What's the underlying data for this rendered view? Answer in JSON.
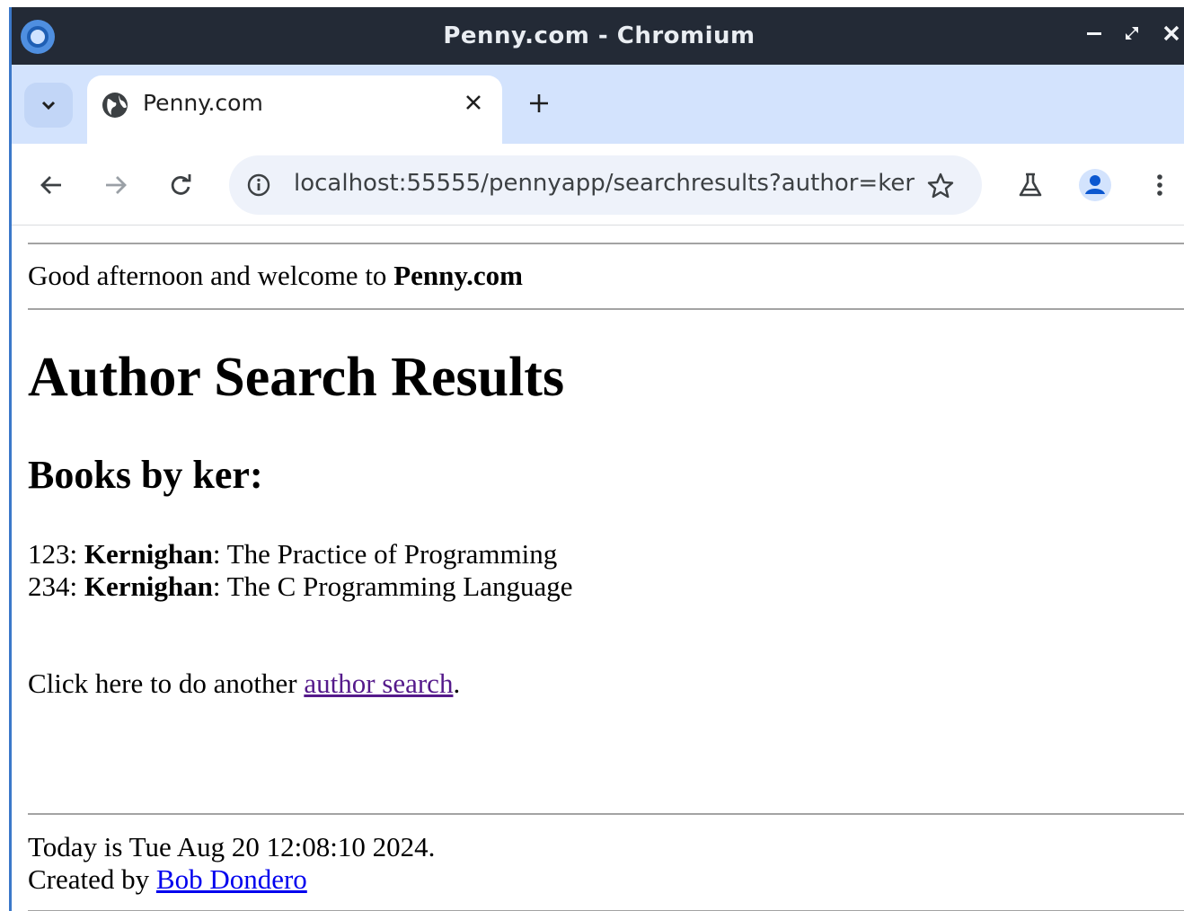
{
  "window": {
    "title": "Penny.com - Chromium"
  },
  "tabs": [
    {
      "label": "Penny.com"
    }
  ],
  "toolbar": {
    "url": "localhost:55555/pennyapp/searchresults?author=ker"
  },
  "icons": {
    "app": "chromium-icon",
    "tab_list": "chevron-down-icon",
    "favicon": "globe-icon",
    "tab_close": "close-icon",
    "new_tab": "plus-icon",
    "back": "back-arrow-icon",
    "forward": "forward-arrow-icon",
    "reload": "reload-icon",
    "site_info": "info-icon",
    "bookmark": "star-icon",
    "labs": "flask-icon",
    "profile": "profile-icon",
    "menu": "kebab-menu-icon",
    "minimize": "minimize-icon",
    "maximize": "maximize-icon",
    "close": "close-icon"
  },
  "page": {
    "greeting_prefix": "Good afternoon and welcome to ",
    "greeting_site": "Penny.com",
    "heading": "Author Search Results",
    "subheading": "Books by ker:",
    "books": [
      {
        "isbn": "123",
        "sep1": ": ",
        "author": "Kernighan",
        "sep2": ": ",
        "title": "The Practice of Programming"
      },
      {
        "isbn": "234",
        "sep1": ": ",
        "author": "Kernighan",
        "sep2": ": ",
        "title": "The C Programming Language"
      }
    ],
    "again_prefix": "Click here to do another ",
    "again_link": "author search",
    "again_suffix": ".",
    "footer_date": "Today is Tue Aug 20 12:08:10 2024.",
    "footer_created_prefix": "Created by ",
    "footer_author_link": "Bob Dondero"
  },
  "colors": {
    "titlebar": "#232a36",
    "tabstrip": "#d3e3fd",
    "visited_link": "#551a8b",
    "link": "#0000ee",
    "accent": "#1a73e8"
  }
}
